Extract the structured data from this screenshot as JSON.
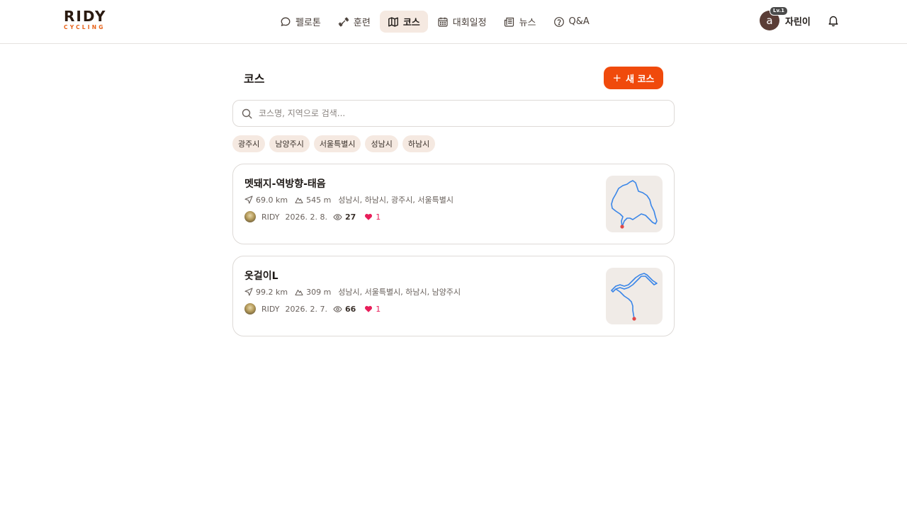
{
  "brand": {
    "name": "RIDY",
    "tagline": "CYCLING",
    "accent": "#e8631a"
  },
  "nav": {
    "items": [
      {
        "label": "펠로톤",
        "icon": "chat-bubble-icon",
        "active": false
      },
      {
        "label": "훈련",
        "icon": "dumbbell-icon",
        "active": false
      },
      {
        "label": "코스",
        "icon": "map-icon",
        "active": true
      },
      {
        "label": "대회일정",
        "icon": "calendar-icon",
        "active": false
      },
      {
        "label": "뉴스",
        "icon": "newspaper-icon",
        "active": false
      },
      {
        "label": "Q&A",
        "icon": "help-circle-icon",
        "active": false
      }
    ]
  },
  "user": {
    "avatar_letter": "a",
    "level": "Lv.1",
    "name": "자린이"
  },
  "page": {
    "title": "코스",
    "new_button": {
      "icon": "+",
      "label": "새 코스",
      "color": "#f04a0c"
    }
  },
  "search": {
    "placeholder": "코스명, 지역으로 검색...",
    "value": ""
  },
  "filters": [
    "광주시",
    "남양주시",
    "서울특별시",
    "성남시",
    "하남시"
  ],
  "courses": [
    {
      "title": "멧돼지-역방향-태음",
      "distance": "69.0 km",
      "elevation": "545 m",
      "regions": "성남시, 하남시, 광주시, 서울특별시",
      "author": "RIDY",
      "date": "2026. 2. 8.",
      "views": "27",
      "likes": "1"
    },
    {
      "title": "옷걸이L",
      "distance": "99.2 km",
      "elevation": "309 m",
      "regions": "성남시, 서울특별시, 하남시, 남양주시",
      "author": "RIDY",
      "date": "2026. 2. 7.",
      "views": "66",
      "likes": "1"
    }
  ]
}
